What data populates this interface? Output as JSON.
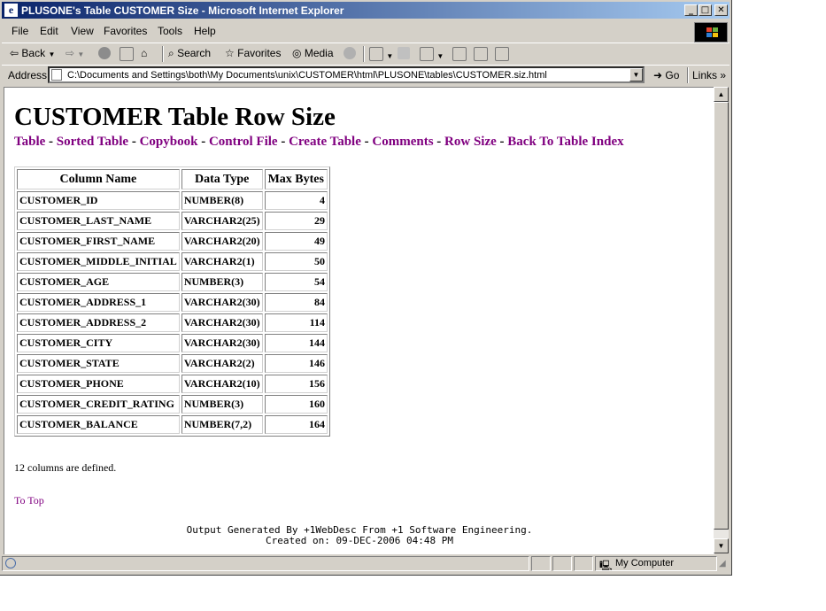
{
  "window": {
    "title": "PLUSONE's Table CUSTOMER Size - Microsoft Internet Explorer",
    "minimize": "_",
    "maximize": "□",
    "close": "✕"
  },
  "menu": [
    "File",
    "Edit",
    "View",
    "Favorites",
    "Tools",
    "Help"
  ],
  "toolbar": {
    "back": "Back",
    "search": "Search",
    "favorites": "Favorites",
    "media": "Media"
  },
  "address": {
    "label": "Address",
    "url": "C:\\Documents and Settings\\both\\My Documents\\unix\\CUSTOMER\\html\\PLUSONE\\tables\\CUSTOMER.siz.html",
    "go": "Go",
    "links": "Links"
  },
  "page": {
    "heading": "CUSTOMER Table Row Size",
    "nav": [
      "Table",
      "Sorted Table",
      "Copybook",
      "Control File",
      "Create Table",
      "Comments",
      "Row Size",
      "Back To Table Index"
    ],
    "nav_separator": " - ",
    "table_headers": [
      "Column Name",
      "Data Type",
      "Max Bytes"
    ],
    "rows": [
      [
        "CUSTOMER_ID",
        "NUMBER(8)",
        "4"
      ],
      [
        "CUSTOMER_LAST_NAME",
        "VARCHAR2(25)",
        "29"
      ],
      [
        "CUSTOMER_FIRST_NAME",
        "VARCHAR2(20)",
        "49"
      ],
      [
        "CUSTOMER_MIDDLE_INITIAL",
        "VARCHAR2(1)",
        "50"
      ],
      [
        "CUSTOMER_AGE",
        "NUMBER(3)",
        "54"
      ],
      [
        "CUSTOMER_ADDRESS_1",
        "VARCHAR2(30)",
        "84"
      ],
      [
        "CUSTOMER_ADDRESS_2",
        "VARCHAR2(30)",
        "114"
      ],
      [
        "CUSTOMER_CITY",
        "VARCHAR2(30)",
        "144"
      ],
      [
        "CUSTOMER_STATE",
        "VARCHAR2(2)",
        "146"
      ],
      [
        "CUSTOMER_PHONE",
        "VARCHAR2(10)",
        "156"
      ],
      [
        "CUSTOMER_CREDIT_RATING",
        "NUMBER(3)",
        "160"
      ],
      [
        "CUSTOMER_BALANCE",
        "NUMBER(7,2)",
        "164"
      ]
    ],
    "column_count_text": "12 columns are defined.",
    "to_top": "To Top",
    "footer_line1": "Output Generated By +1WebDesc From +1 Software Engineering.",
    "footer_line2": "Created on: 09-DEC-2006 04:48 PM"
  },
  "status": {
    "zone": "My Computer"
  },
  "colors": {
    "visited_link": "#800080",
    "title_bar": "#0a246a",
    "chrome": "#d4d0c8"
  }
}
